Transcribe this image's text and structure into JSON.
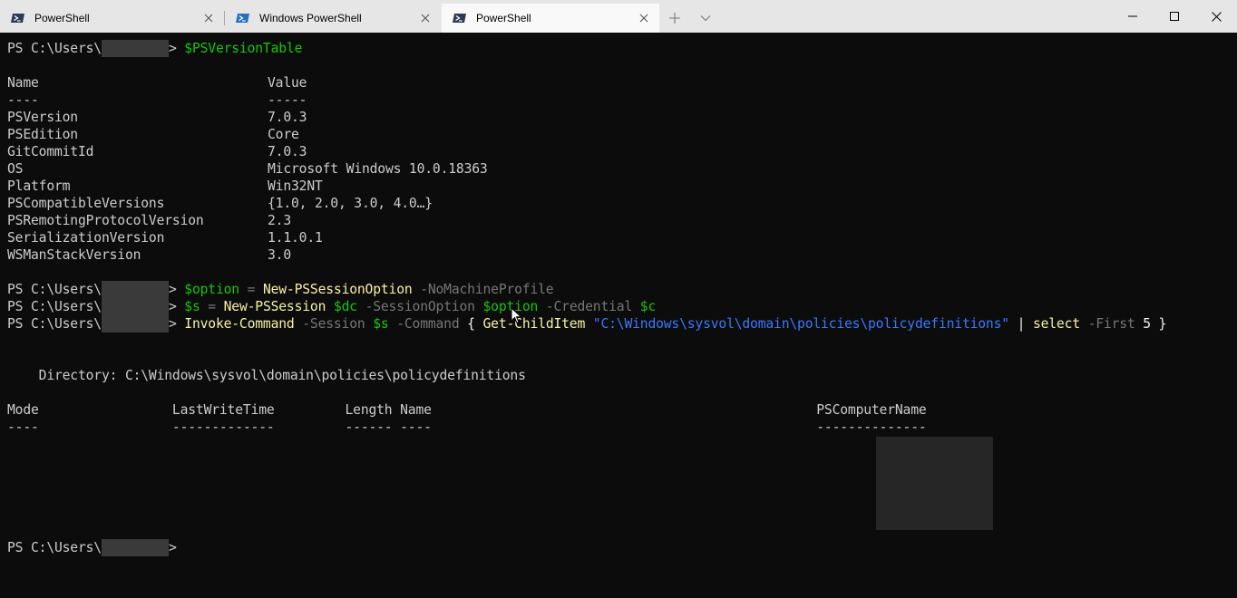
{
  "tabs": [
    {
      "label": "PowerShell",
      "active": false
    },
    {
      "label": "Windows PowerShell",
      "active": false
    },
    {
      "label": "PowerShell",
      "active": true
    }
  ],
  "window_controls": {
    "minimize": "minimize-icon",
    "maximize": "maximize-icon",
    "close": "close-icon"
  },
  "terminal": {
    "prompt": "PS C:\\Users\\",
    "cmd1": "$PSVersionTable",
    "table1": {
      "header": {
        "name": "Name",
        "value": "Value"
      },
      "rule": {
        "name": "----",
        "value": "-----"
      },
      "rows": [
        {
          "name": "PSVersion",
          "value": "7.0.3"
        },
        {
          "name": "PSEdition",
          "value": "Core"
        },
        {
          "name": "GitCommitId",
          "value": "7.0.3"
        },
        {
          "name": "OS",
          "value": "Microsoft Windows 10.0.18363"
        },
        {
          "name": "Platform",
          "value": "Win32NT"
        },
        {
          "name": "PSCompatibleVersions",
          "value": "{1.0, 2.0, 3.0, 4.0…}"
        },
        {
          "name": "PSRemotingProtocolVersion",
          "value": "2.3"
        },
        {
          "name": "SerializationVersion",
          "value": "1.1.0.1"
        },
        {
          "name": "WSManStackVersion",
          "value": "3.0"
        }
      ]
    },
    "cmd2": {
      "var": "$option",
      "eq": " = ",
      "cmdlet": "New-PSSessionOption",
      "param": " -NoMachineProfile"
    },
    "cmd3": {
      "var": "$s",
      "eq": " = ",
      "cmdlet": "New-PSSession",
      "arg1": " $dc",
      "param1": " -SessionOption",
      "arg2": " $option",
      "param2": " -Credential",
      "arg3": " $c"
    },
    "cmd4": {
      "cmdlet": "Invoke-Command",
      "param1": " -Session",
      "arg1": " $s",
      "param2": " -Command",
      "brace_open": " { ",
      "cmdlet2": "Get-ChildItem",
      "path": " \"C:\\Windows\\sysvol\\domain\\policies\\policydefinitions\"",
      "pipe": " | ",
      "cmdlet3": "select",
      "param3": " -First",
      "num": " 5",
      "brace_close": " }"
    },
    "directory_line": "    Directory: C:\\Windows\\sysvol\\domain\\policies\\policydefinitions",
    "table2_header": "Mode                 LastWriteTime         Length Name                                                 PSComputerName",
    "table2_rule": "----                 -------------         ------ ----                                                 --------------",
    "final_prompt_suffix": ">"
  }
}
